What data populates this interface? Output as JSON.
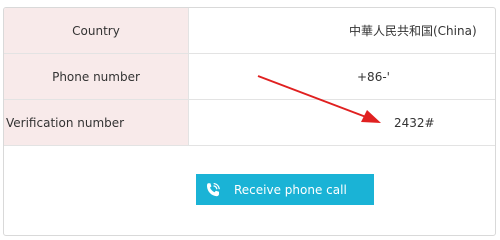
{
  "form": {
    "country": {
      "label": "Country",
      "value": "中華人民共和国(China)"
    },
    "phone": {
      "label": "Phone number",
      "value": "+86-'"
    },
    "verification": {
      "label": "Verification number",
      "value": "2432#"
    }
  },
  "call_button": {
    "label": "Receive phone call",
    "icon": "phone-call-icon"
  },
  "annotation": {
    "arrow_color": "#e02020"
  },
  "colors": {
    "label_background": "#f8eaea",
    "button_background": "#1ab3d6"
  }
}
